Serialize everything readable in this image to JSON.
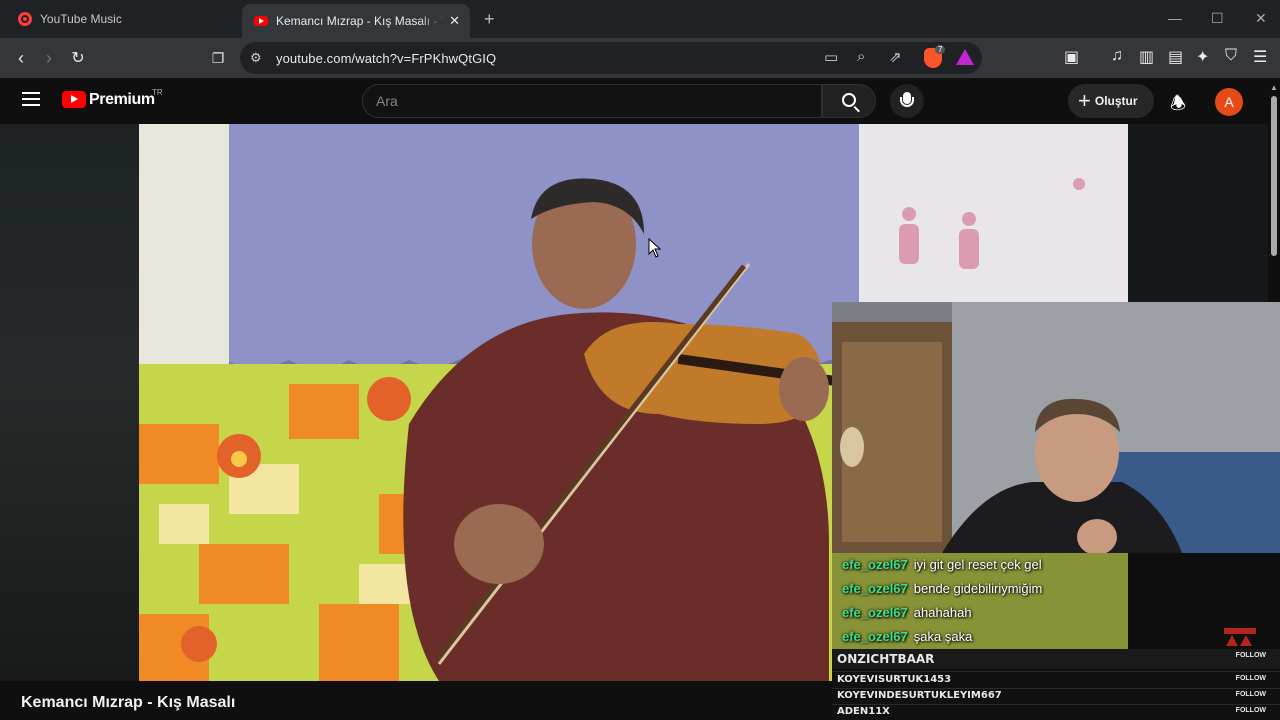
{
  "browser": {
    "tabs": [
      {
        "title": "YouTube Music",
        "active": false
      },
      {
        "title": "Kemancı Mızrap - Kış Masalı - YouTube",
        "active": true
      }
    ],
    "new_tab_icon": "plus-icon",
    "window_controls": [
      "minimize-icon",
      "maximize-icon",
      "close-icon"
    ],
    "url": "youtube.com/watch?v=FrPKhwQtGIQ",
    "shields_badge": "7"
  },
  "youtube": {
    "brand": "Premium",
    "region": "TR",
    "search_placeholder": "Ara",
    "create_label": "Oluştur",
    "avatar_letter": "A",
    "brand_color": "#ff0000",
    "avatar_color": "#e64a19"
  },
  "video": {
    "title": "Kemancı Mızrap - Kış Masalı"
  },
  "stream_chat": [
    {
      "user": "efe_ozel67",
      "message": "iyi git gel reset çek gel"
    },
    {
      "user": "efe_ozel67",
      "message": "bende gidebiliriymiğim"
    },
    {
      "user": "efe_ozel67",
      "message": "ahahahah"
    },
    {
      "user": "efe_ozel67",
      "message": "şaka şaka"
    }
  ],
  "followers": {
    "latest": "ONZICHTBAAR",
    "list": [
      "KOYEVISURTUK1453",
      "KOYEVINDESURTUKLEYIM667",
      "ADEN11X"
    ],
    "tag": "FOLLOW"
  },
  "colors": {
    "chat_username": "#3ee08a",
    "tab_bar": "#202124",
    "toolbar": "#35363a",
    "page_bg": "#0f0f0f"
  }
}
